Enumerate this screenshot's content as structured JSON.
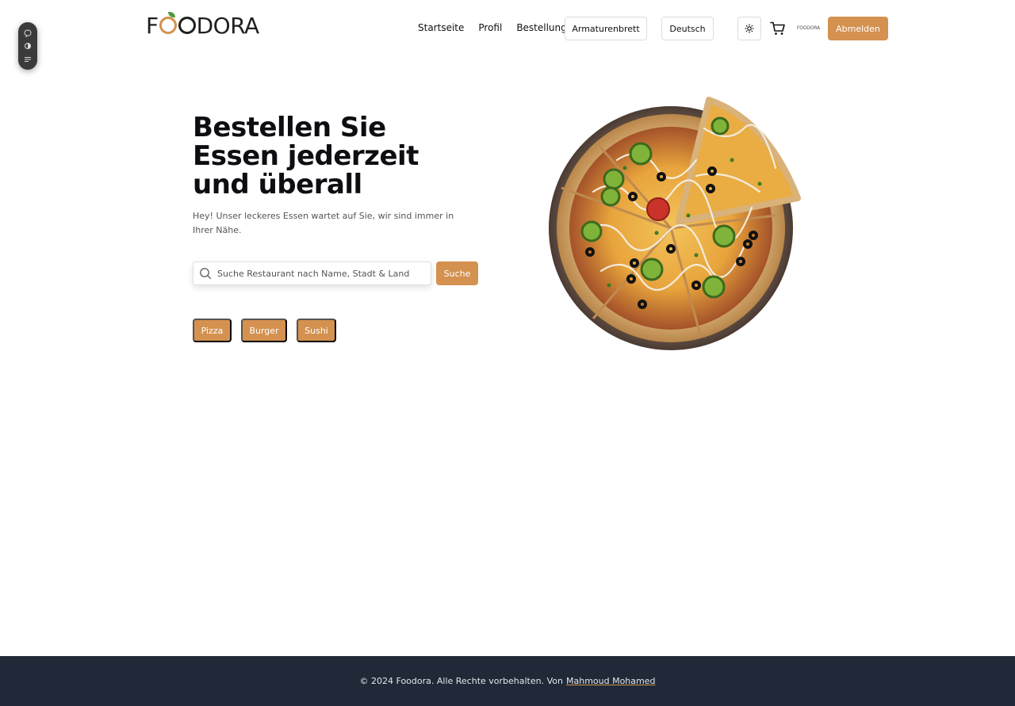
{
  "app": {
    "logo_text_before": "F",
    "logo_text_after": "DORA",
    "mini_logo_text": "FOODORA",
    "brand_color": "#d4914f"
  },
  "nav": {
    "items": [
      {
        "label": "Startseite"
      },
      {
        "label": "Profil"
      },
      {
        "label": "Bestellung"
      }
    ],
    "dashboard_label": "Armaturenbrett",
    "language_label": "Deutsch",
    "logout_label": "Abmelden"
  },
  "icons": {
    "theme": "sun-icon",
    "cart": "cart-icon",
    "search": "search-icon",
    "side_toolbar": [
      "comment-icon",
      "toggle-icon",
      "settings-list-icon"
    ]
  },
  "hero": {
    "title": "Bestellen Sie Essen jederzeit und überall",
    "subtitle": "Hey! Unser leckeres Essen wartet auf Sie, wir sind immer in Ihrer Nähe.",
    "search_placeholder": "Suche Restaurant nach Name, Stadt & Land",
    "search_value": "",
    "search_button": "Suche",
    "categories": [
      "Pizza",
      "Burger",
      "Sushi"
    ]
  },
  "footer": {
    "text": "© 2024 Foodora. Alle Rechte vorbehalten. Von",
    "author_link": "Mahmoud Mohamed"
  }
}
